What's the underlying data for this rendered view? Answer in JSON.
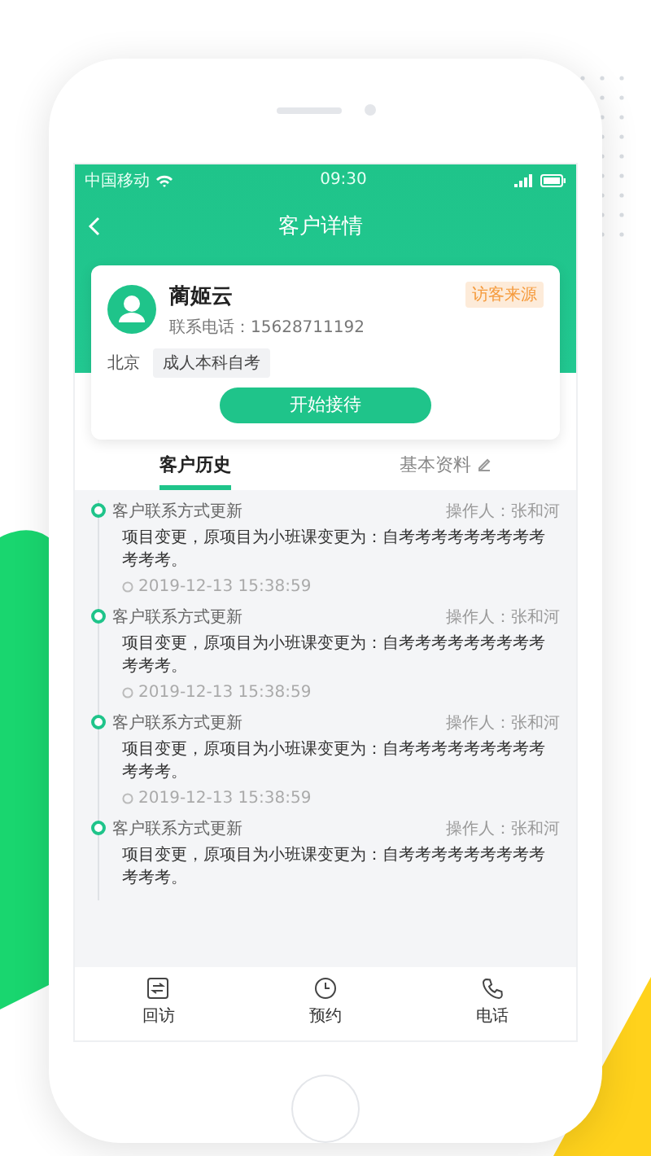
{
  "status_bar": {
    "carrier": "中国移动",
    "time": "09:30"
  },
  "header": {
    "title": "客户详情"
  },
  "customer": {
    "name": "蔺姬云",
    "source_badge": "访客来源",
    "phone": "联系电话：15628711192",
    "location": "北京",
    "tags": [
      "成人本科自考"
    ],
    "action": "开始接待"
  },
  "tabs": [
    {
      "label": "客户历史",
      "selected": true,
      "kind": "plain"
    },
    {
      "label": "基本资料",
      "selected": false,
      "kind": "edit"
    }
  ],
  "history": [
    {
      "title": "客户联系方式更新",
      "operator": "操作人：张和河",
      "text": "项目变更，原项目为小班课变更为：自考考考考考考考考考考考考。",
      "date": "2019-12-13  15:38:59"
    },
    {
      "title": "客户联系方式更新",
      "operator": "操作人：张和河",
      "text": "项目变更，原项目为小班课变更为：自考考考考考考考考考考考考。",
      "date": "2019-12-13  15:38:59"
    },
    {
      "title": "客户联系方式更新",
      "operator": "操作人：张和河",
      "text": "项目变更，原项目为小班课变更为：自考考考考考考考考考考考考。",
      "date": "2019-12-13  15:38:59"
    },
    {
      "title": "客户联系方式更新",
      "operator": "操作人：张和河",
      "text": "项目变更，原项目为小班课变更为：自考考考考考考考考考考考考。"
    }
  ],
  "bottom_nav": [
    {
      "label": "回访",
      "kind": "revisit"
    },
    {
      "label": "预约",
      "kind": "appointment"
    },
    {
      "label": "电话",
      "kind": "phone"
    }
  ]
}
